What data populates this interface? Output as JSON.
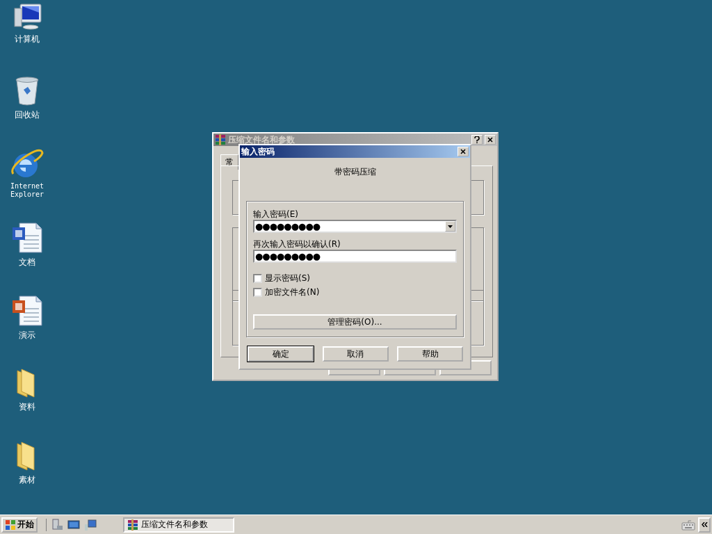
{
  "desktop_icons": [
    {
      "label": "计算机",
      "kind": "computer"
    },
    {
      "label": "回收站",
      "kind": "recycle"
    },
    {
      "label": "Internet Explorer",
      "kind": "browser"
    },
    {
      "label": "文档",
      "kind": "word"
    },
    {
      "label": "演示",
      "kind": "slides"
    },
    {
      "label": "资料",
      "kind": "folder"
    },
    {
      "label": "素材",
      "kind": "folder"
    }
  ],
  "background_window": {
    "title": "压缩文件名和参数",
    "tab": "常"
  },
  "dialog": {
    "title": "输入密码",
    "heading": "带密码压缩",
    "password_label": "输入密码(E)",
    "password": {
      "value": "●●●●●●●●●"
    },
    "confirm_label": "再次输入密码以确认(R)",
    "confirm": {
      "value": "●●●●●●●●●"
    },
    "options": [
      {
        "label": "显示密码(S)",
        "checked": false
      },
      {
        "label": "加密文件名(N)",
        "checked": false
      }
    ],
    "manage_button": "管理密码(O)...",
    "buttons": [
      {
        "label": "确定",
        "default": true
      },
      {
        "label": "取消",
        "default": false
      },
      {
        "label": "帮助",
        "default": false
      }
    ]
  },
  "taskbar": {
    "start": "开始",
    "tasks": [
      {
        "label": "压缩文件名和参数",
        "selected": true
      }
    ]
  }
}
